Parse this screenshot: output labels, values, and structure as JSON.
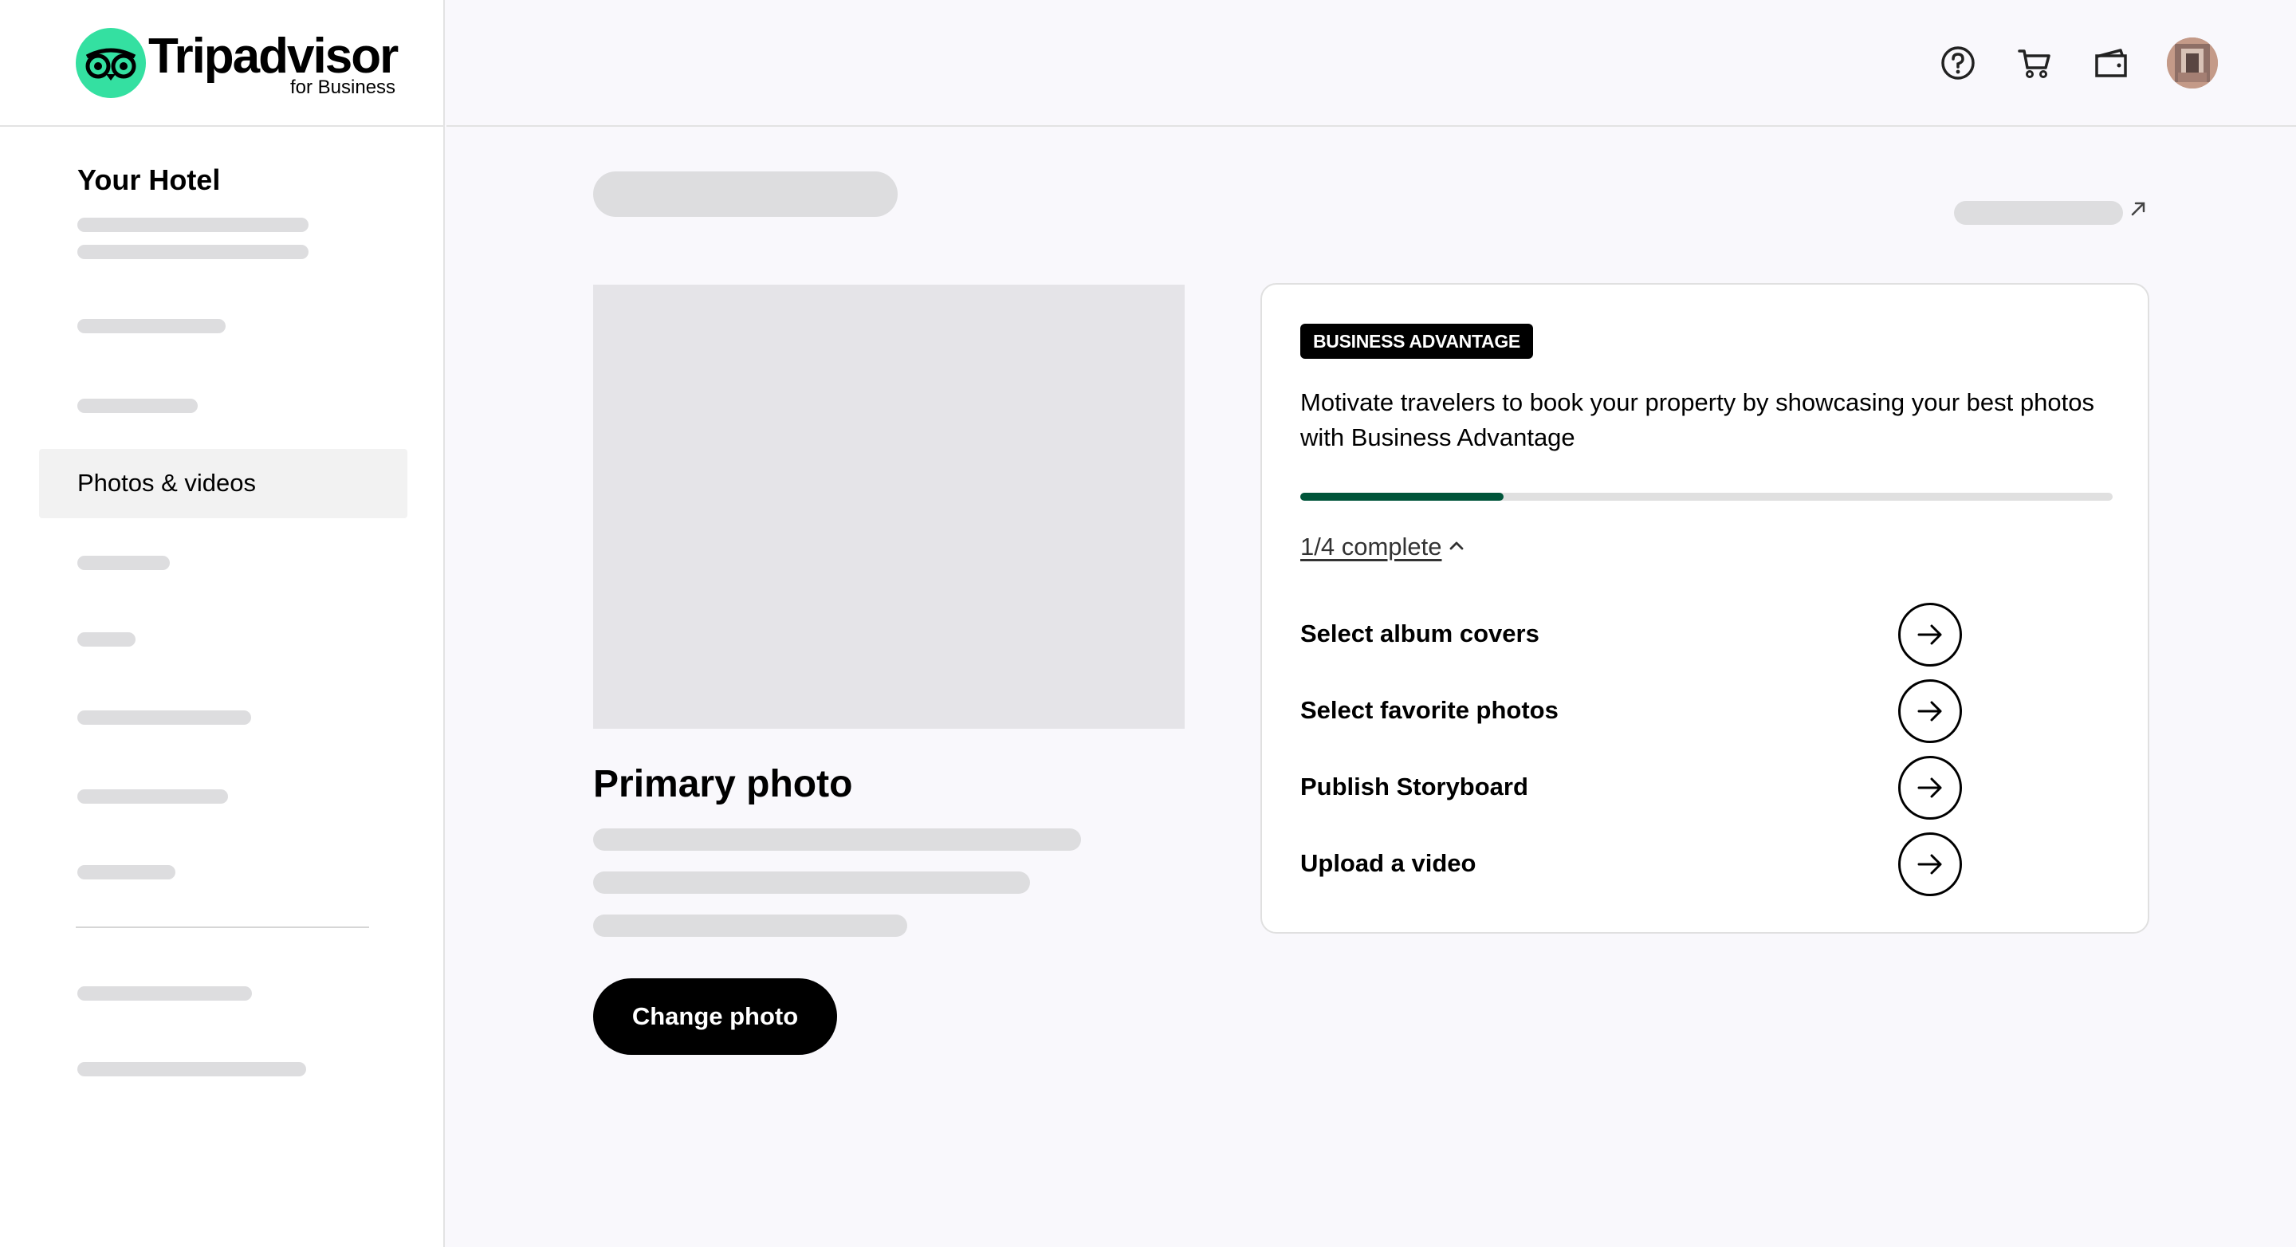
{
  "brand": {
    "name": "Tripadvisor",
    "subtitle": "for Business",
    "accent": "#34e0a1"
  },
  "sidebar": {
    "hotel_title": "Your Hotel",
    "active_item": "Photos & videos"
  },
  "header": {
    "icons": [
      "help-icon",
      "cart-icon",
      "wallet-icon",
      "avatar"
    ]
  },
  "main": {
    "primary_photo_title": "Primary photo",
    "change_photo_button": "Change photo"
  },
  "card": {
    "badge": "BUSINESS ADVANTAGE",
    "description": "Motivate travelers to book your property by showcasing your best photos with Business Advantage",
    "progress": {
      "completed": 1,
      "total": 4,
      "fraction": 0.25,
      "label": "1/4 complete",
      "color": "#00553a"
    },
    "tasks": [
      {
        "label": "Select album covers"
      },
      {
        "label": "Select favorite photos"
      },
      {
        "label": "Publish Storyboard"
      },
      {
        "label": "Upload a video"
      }
    ]
  }
}
